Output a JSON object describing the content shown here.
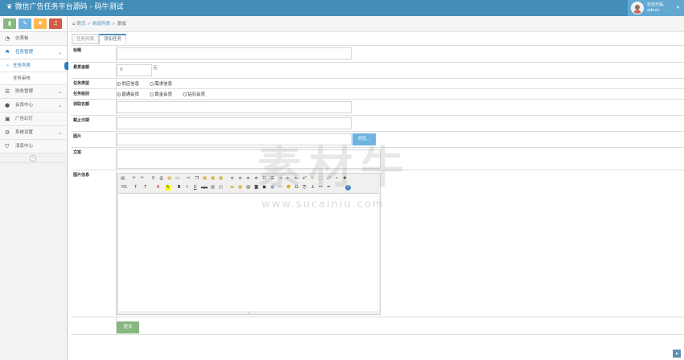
{
  "app": {
    "title": "微信广告任务平台源码 - 码牛测试",
    "brand_icon": "leaf-icon"
  },
  "user": {
    "greeting": "欢迎光临,",
    "name": "admin"
  },
  "shortcuts": [
    {
      "icon": "signal-icon",
      "color": "#87b87f"
    },
    {
      "icon": "pencil-icon",
      "color": "#6fb3e0"
    },
    {
      "icon": "users-icon",
      "color": "#ffb752"
    },
    {
      "icon": "bell-icon",
      "color": "#d15b47"
    }
  ],
  "sidebar": {
    "dashboard": "仪表板",
    "task_mgmt": "任务管理",
    "task_list": "任务列表",
    "task_review": "任务审核",
    "finance": "财务管理",
    "members": "会员中心",
    "ads": "广告幻灯",
    "settings": "系统设置",
    "messages": "消息中心"
  },
  "breadcrumb": {
    "home": "首页",
    "section": "新闻列表",
    "current": "添加"
  },
  "tabs": {
    "list": "任务列表",
    "add": "添加任务"
  },
  "form": {
    "title_label": "标题",
    "amount_label": "悬赏金额",
    "amount_value": "8",
    "amount_unit": "元",
    "type_label": "任务类型",
    "type_options": [
      "供应信息",
      "需求信息"
    ],
    "level_label": "任务级别",
    "level_options": [
      "普通会员",
      "黄金会员",
      "钻石会员"
    ],
    "limit_label": "领取名额",
    "deadline_label": "截止日期",
    "image_label": "图片",
    "browse": "浏览...",
    "copy_label": "文案",
    "detail_label": "图片信息",
    "submit": "提交"
  },
  "editor": {
    "row2": [
      "H1",
      "T",
      "T",
      "A",
      "A",
      "B",
      "I",
      "U",
      "ABC"
    ]
  },
  "watermark": {
    "text": "素材牛",
    "url": "www.sucainiu.com"
  }
}
